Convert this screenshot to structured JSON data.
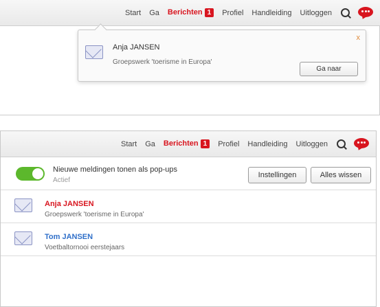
{
  "nav": {
    "items": [
      "Start",
      "Ga",
      "Berichten",
      "Profiel",
      "Handleiding",
      "Uitloggen"
    ],
    "badge": "1"
  },
  "top": {
    "nav_items": [
      "Start",
      "Ga",
      "Berichten",
      "Profiel",
      "Handleiding",
      "Uitloggen"
    ],
    "toast": {
      "close": "x",
      "name": "Anja JANSEN",
      "subject": "Groepswerk 'toerisme in Europa'",
      "button": "Ga naar"
    }
  },
  "bottom": {
    "toggle_label": "Nieuwe meldingen tonen als pop-ups",
    "toggle_state": "Actief",
    "settings_button": "Instellingen",
    "clear_button": "Alles wissen",
    "messages": [
      {
        "name": "Anja JANSEN",
        "subject": "Groepswerk 'toerisme in Europa'",
        "color": "#d8151f"
      },
      {
        "name": "Tom JANSEN",
        "subject": "Voetbaltornooi eerstejaars",
        "color": "#2f6fc9"
      }
    ]
  },
  "colors": {
    "accent": "#d8151f",
    "toggle_on": "#5cb82c",
    "link": "#2f6fc9"
  },
  "icons": [
    "search-icon",
    "chat-icon",
    "envelope-icon",
    "close-icon"
  ]
}
